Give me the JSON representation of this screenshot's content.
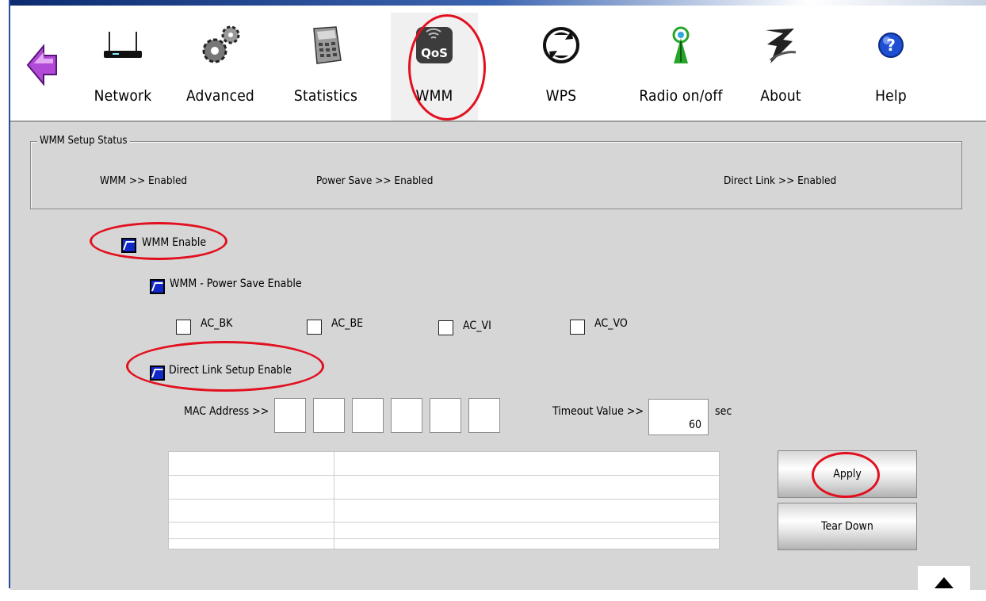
{
  "toolbar": {
    "items": [
      {
        "label": "Network",
        "icon": "router-icon"
      },
      {
        "label": "Advanced",
        "icon": "gears-icon"
      },
      {
        "label": "Statistics",
        "icon": "calculator-icon"
      },
      {
        "label": "WMM",
        "icon": "qos-icon",
        "icon_text": "QoS",
        "active": true
      },
      {
        "label": "WPS",
        "icon": "wps-icon"
      },
      {
        "label": "Radio on/off",
        "icon": "radio-antenna-icon"
      },
      {
        "label": "About",
        "icon": "about-logo-icon"
      },
      {
        "label": "Help",
        "icon": "help-icon"
      }
    ]
  },
  "status": {
    "title": "WMM Setup Status",
    "wmm": "WMM >> Enabled",
    "power_save": "Power Save >> Enabled",
    "direct_link": "Direct Link >> Enabled"
  },
  "options": {
    "wmm_enable": {
      "label": "WMM Enable",
      "checked": true
    },
    "power_save_enable": {
      "label": "WMM - Power Save Enable",
      "checked": true
    },
    "ac": [
      {
        "label": "AC_BK",
        "checked": false
      },
      {
        "label": "AC_BE",
        "checked": false
      },
      {
        "label": "AC_VI",
        "checked": false
      },
      {
        "label": "AC_VO",
        "checked": false
      }
    ],
    "direct_link_enable": {
      "label": "Direct Link Setup Enable",
      "checked": true
    }
  },
  "direct_link": {
    "mac_label": "MAC Address >>",
    "timeout_label": "Timeout Value >>",
    "timeout_value": "60",
    "timeout_unit": "sec"
  },
  "buttons": {
    "apply": "Apply",
    "tear_down": "Tear Down"
  },
  "colors": {
    "highlight_circle": "#e2101f",
    "checkbox_checked": "#1029c8",
    "panel_bg": "#d6d6d6"
  }
}
